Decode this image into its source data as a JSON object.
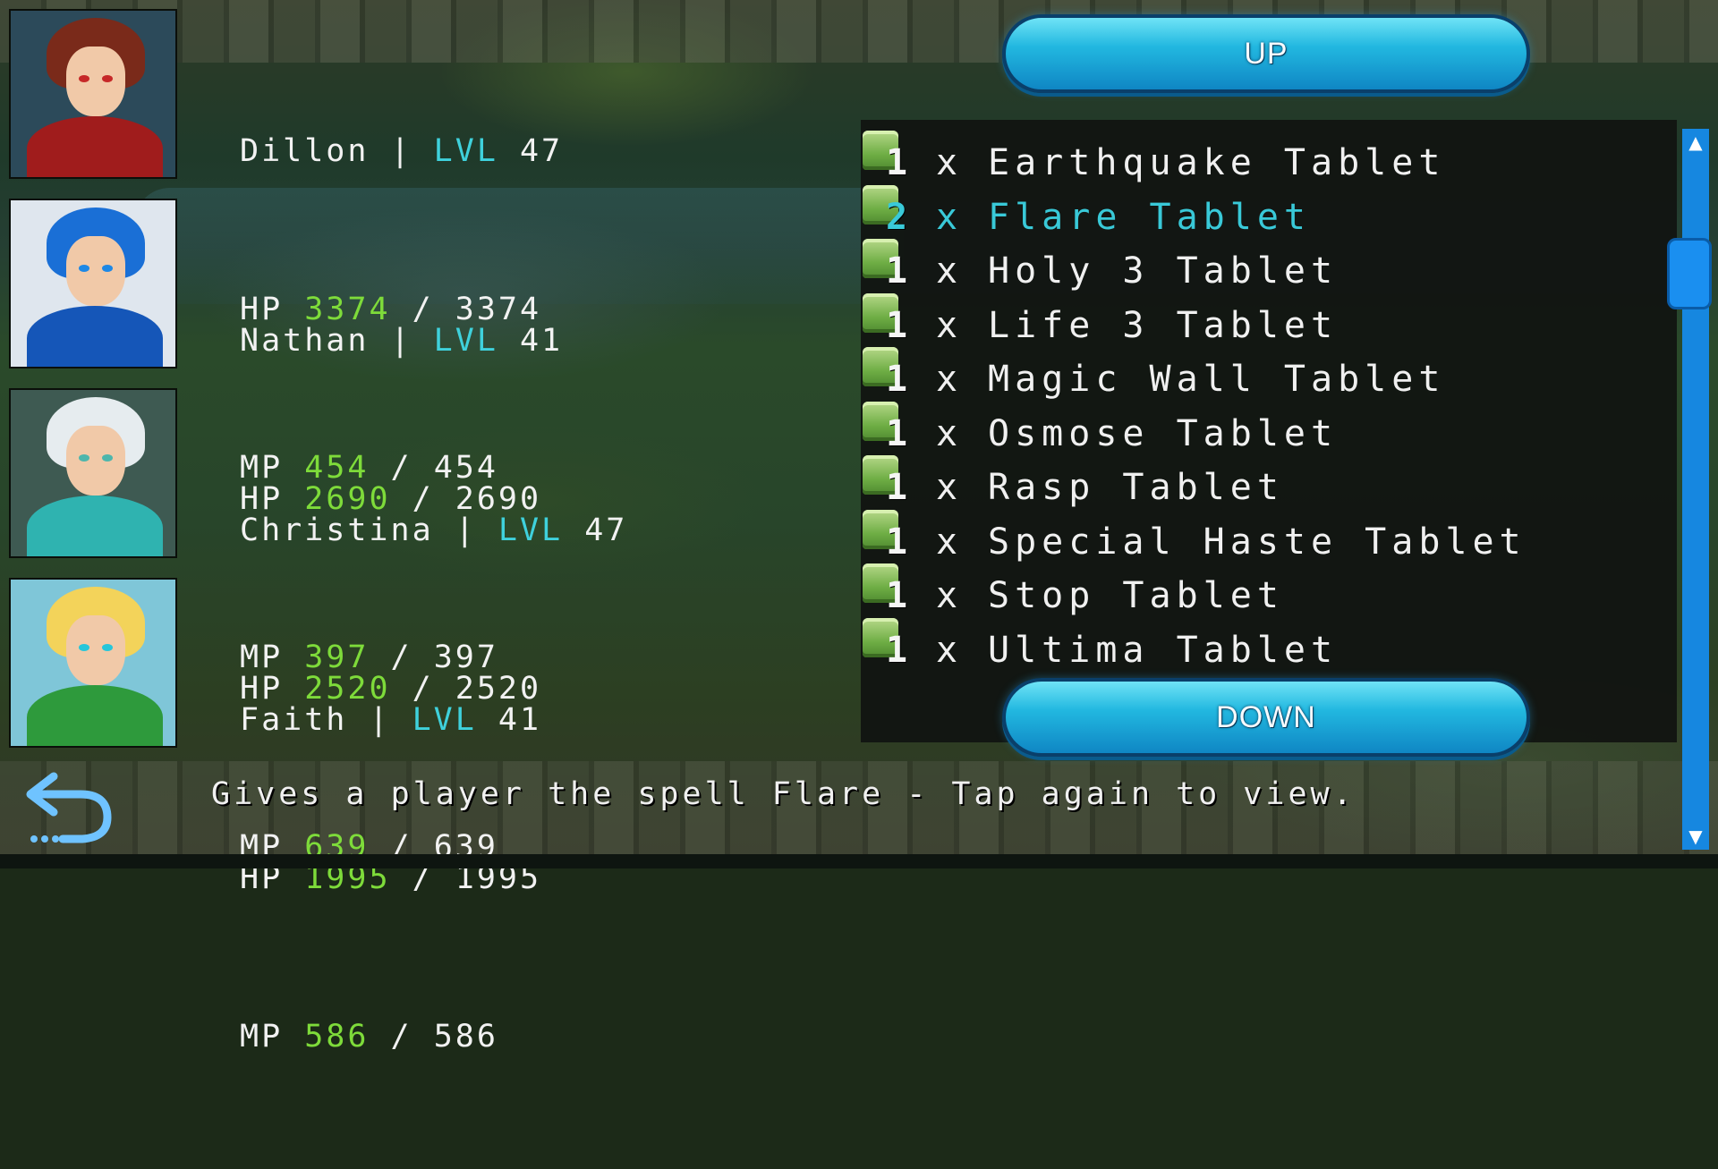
{
  "party": [
    {
      "name": "Dillon",
      "separator": "|",
      "lvl_label": "LVL",
      "level": "47",
      "hp_label": "HP",
      "hp": "3374",
      "hp_max": "3374",
      "mp_label": "MP",
      "mp": "454",
      "mp_max": "454",
      "slash": "/",
      "portrait_colors": {
        "bg": "#2c4a5a",
        "hair": "#7a2a1a",
        "body": "#a01c1c",
        "eye": "#c62828"
      }
    },
    {
      "name": "Nathan",
      "separator": "|",
      "lvl_label": "LVL",
      "level": "41",
      "hp_label": "HP",
      "hp": "2690",
      "hp_max": "2690",
      "mp_label": "MP",
      "mp": "397",
      "mp_max": "397",
      "slash": "/",
      "portrait_colors": {
        "bg": "#dfe6ee",
        "hair": "#1a6fd6",
        "body": "#1556b8",
        "eye": "#1e88e5"
      }
    },
    {
      "name": "Christina",
      "separator": "|",
      "lvl_label": "LVL",
      "level": "47",
      "hp_label": "HP",
      "hp": "2520",
      "hp_max": "2520",
      "mp_label": "MP",
      "mp": "639",
      "mp_max": "639",
      "slash": "/",
      "portrait_colors": {
        "bg": "#3e5a52",
        "hair": "#e6ecef",
        "body": "#2fb3b0",
        "eye": "#4db6ac"
      }
    },
    {
      "name": "Faith",
      "separator": "|",
      "lvl_label": "LVL",
      "level": "41",
      "hp_label": "HP",
      "hp": "1995",
      "hp_max": "1995",
      "mp_label": "MP",
      "mp": "586",
      "mp_max": "586",
      "slash": "/",
      "portrait_colors": {
        "bg": "#7fc6d8",
        "hair": "#f3d35a",
        "body": "#2e9a3c",
        "eye": "#26c6da"
      }
    }
  ],
  "inventory": {
    "up_button": "UP",
    "down_button": "DOWN",
    "multiplier": "x",
    "selected_index": 1,
    "items": [
      {
        "qty": "1",
        "name": "Earthquake Tablet"
      },
      {
        "qty": "2",
        "name": "Flare Tablet"
      },
      {
        "qty": "1",
        "name": "Holy 3 Tablet"
      },
      {
        "qty": "1",
        "name": "Life 3 Tablet"
      },
      {
        "qty": "1",
        "name": "Magic Wall Tablet"
      },
      {
        "qty": "1",
        "name": "Osmose Tablet"
      },
      {
        "qty": "1",
        "name": "Rasp Tablet"
      },
      {
        "qty": "1",
        "name": "Special Haste Tablet"
      },
      {
        "qty": "1",
        "name": "Stop Tablet"
      },
      {
        "qty": "1",
        "name": "Ultima Tablet"
      }
    ]
  },
  "footer": {
    "description": "Gives a player the spell Flare - Tap again to view."
  },
  "icons": {
    "back": "back-arrow-icon",
    "tablet": "tablet-icon",
    "scroll_up": "chevron-up-icon",
    "scroll_down": "chevron-down-icon"
  },
  "colors": {
    "level_accent": "#3fd1dc",
    "current_value": "#7edb3a",
    "selected_item": "#39c9d8",
    "button": "#22b8e0",
    "scrollbar": "#1687e0"
  }
}
